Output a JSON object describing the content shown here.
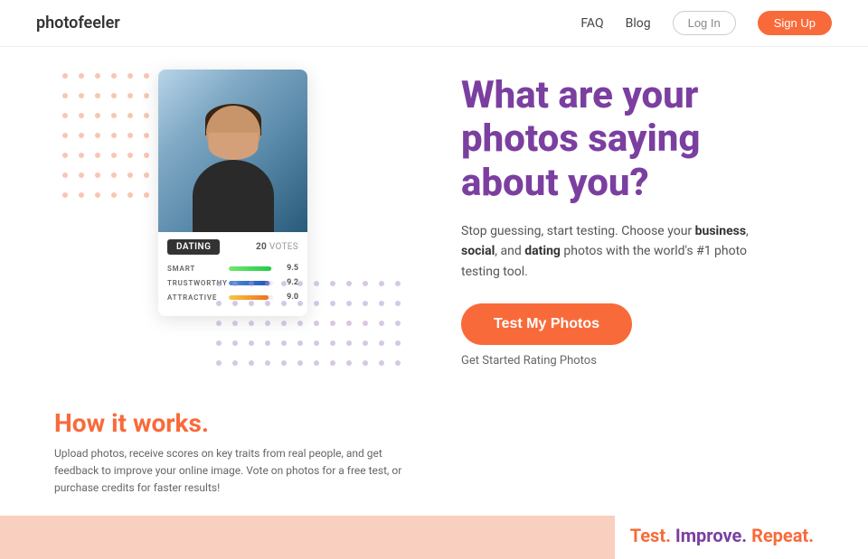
{
  "header": {
    "logo": "photofeeler",
    "nav": {
      "faq": "FAQ",
      "blog": "Blog",
      "login": "Log In",
      "signup": "Sign Up"
    }
  },
  "hero": {
    "headline_line1": "What are your",
    "headline_line2": "photos saying",
    "headline_line3": "about you?",
    "subtext": "Stop guessing, start testing. Choose your ",
    "subtext_bold1": "business",
    "subtext_mid": ", ",
    "subtext_bold2": "social",
    "subtext_end": ", and ",
    "subtext_bold3": "dating",
    "subtext_final": " photos with the world's #1 photo testing tool.",
    "cta_button": "Test My Photos",
    "rating_link": "Get Started Rating Photos"
  },
  "card": {
    "tab": "DATING",
    "votes_num": "20",
    "votes_label": "VOTES",
    "scores": [
      {
        "label": "SMART",
        "value": "9.5",
        "pct": 95,
        "bar": "green"
      },
      {
        "label": "TRUSTWORTHY",
        "value": "9.2",
        "pct": 92,
        "bar": "blue"
      },
      {
        "label": "ATTRACTIVE",
        "value": "9.0",
        "pct": 90,
        "bar": "orange"
      }
    ]
  },
  "how": {
    "title": "How it works.",
    "desc": "Upload photos, receive scores on key traits from real people, and get feedback to improve your online image. Vote on photos for a free test, or purchase credits for faster results!"
  },
  "bottom": {
    "test": "Test.",
    "improve": "Improve.",
    "repeat": "Repeat."
  }
}
